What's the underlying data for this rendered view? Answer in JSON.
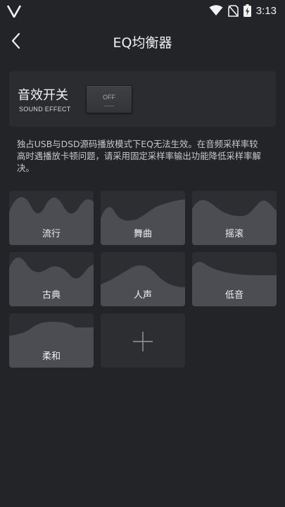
{
  "status_bar": {
    "logo_icon": "v-logo-icon",
    "time": "3:13",
    "icons": [
      "wifi-icon",
      "no-sim-icon",
      "battery-charging-icon"
    ]
  },
  "header": {
    "title": "EQ均衡器",
    "back_icon": "back-arrow-icon"
  },
  "sound_effect": {
    "title": "音效开关",
    "subtitle": "SOUND EFFECT",
    "toggle_state": "OFF"
  },
  "notice": "独占USB与DSD源码播放模式下EQ无法生效。在音频采样率较高时遇播放卡顿问题，请采用固定采样率输出功能降低采样率解决。",
  "presets": [
    {
      "label": "流行"
    },
    {
      "label": "舞曲"
    },
    {
      "label": "摇滚"
    },
    {
      "label": "古典"
    },
    {
      "label": "人声"
    },
    {
      "label": "低音"
    },
    {
      "label": "柔和"
    }
  ],
  "add_preset_icon": "plus-icon",
  "colors": {
    "background": "#232427",
    "card": "#2b2c30",
    "tile": "#2d2e32",
    "wave_fill": "#4c4d52"
  }
}
